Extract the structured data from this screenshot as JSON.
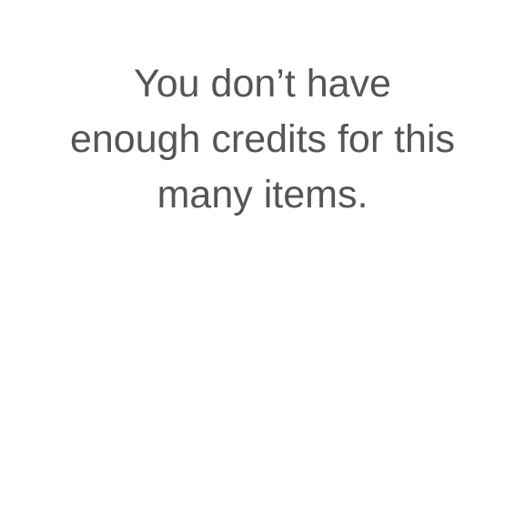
{
  "message": {
    "lines": [
      "You don’t have",
      "enough credits for this",
      "many items."
    ]
  }
}
